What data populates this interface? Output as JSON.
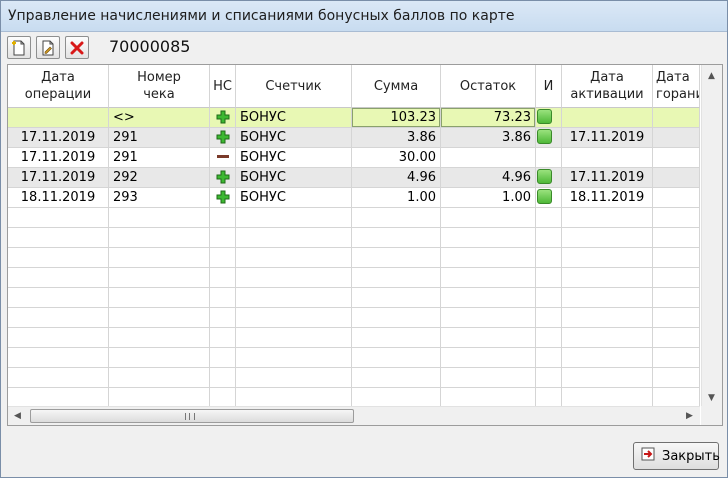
{
  "window": {
    "title": "Управление начислениями и списаниями бонусных баллов по карте"
  },
  "toolbar": {
    "card_number": "70000085",
    "buttons": [
      {
        "name": "add-document-icon"
      },
      {
        "name": "edit-document-icon"
      },
      {
        "name": "delete-x-icon"
      }
    ]
  },
  "table": {
    "columns": [
      {
        "label": "Дата\nоперации",
        "width": 101
      },
      {
        "label": "Номер\nчека",
        "width": 101
      },
      {
        "label": "НС",
        "width": 26
      },
      {
        "label": "Счетчик",
        "width": 116
      },
      {
        "label": "Сумма",
        "width": 89
      },
      {
        "label": "Остаток",
        "width": 95
      },
      {
        "label": "И",
        "width": 26
      },
      {
        "label": "Дата\nактивации",
        "width": 91
      },
      {
        "label": "Дата\nгорани",
        "width": 47
      }
    ],
    "rows": [
      {
        "kind": "summary",
        "date": "",
        "check": "<>",
        "ns": "plus",
        "counter": "БОНУС",
        "sum": "103.23",
        "rest": "73.23",
        "ind": true,
        "act_date": "",
        "burn": ""
      },
      {
        "kind": "shaded",
        "date": "17.11.2019",
        "check": "291",
        "ns": "plus",
        "counter": "БОНУС",
        "sum": "3.86",
        "rest": "3.86",
        "ind": true,
        "act_date": "17.11.2019",
        "burn": ""
      },
      {
        "kind": "white",
        "date": "17.11.2019",
        "check": "291",
        "ns": "minus",
        "counter": "БОНУС",
        "sum": "30.00",
        "rest": "",
        "ind": false,
        "act_date": "",
        "burn": ""
      },
      {
        "kind": "shaded",
        "date": "17.11.2019",
        "check": "292",
        "ns": "plus",
        "counter": "БОНУС",
        "sum": "4.96",
        "rest": "4.96",
        "ind": true,
        "act_date": "17.11.2019",
        "burn": ""
      },
      {
        "kind": "white",
        "date": "18.11.2019",
        "check": "293",
        "ns": "plus",
        "counter": "БОНУС",
        "sum": "1.00",
        "rest": "1.00",
        "ind": true,
        "act_date": "18.11.2019",
        "burn": ""
      }
    ],
    "empty_rows": 10
  },
  "footer": {
    "close_label": "Закрыть"
  },
  "colors": {
    "summary_row": "#e8f8b4",
    "shaded_row": "#e8e8e8",
    "plus_icon": "#3cb832",
    "minus_icon": "#7a3a2a"
  }
}
